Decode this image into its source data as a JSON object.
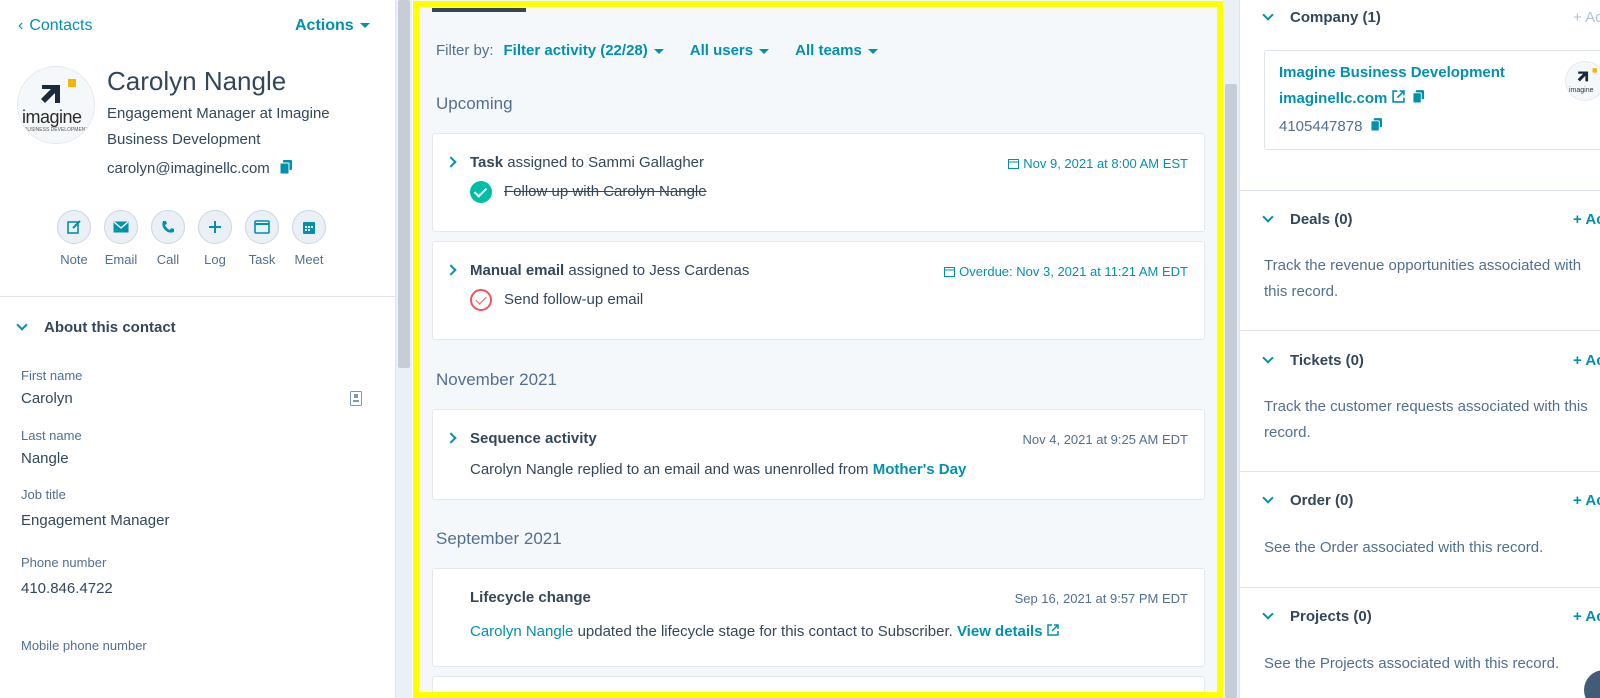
{
  "left": {
    "back_label": "Contacts",
    "actions_label": "Actions",
    "logo_word": "imagine",
    "logo_sub": "BUSINESS DEVELOPMENT",
    "name": "Carolyn Nangle",
    "title": "Engagement Manager at Imagine Business Development",
    "email": "carolyn@imaginellc.com",
    "quick_actions": [
      {
        "label": "Note",
        "icon": "edit-icon"
      },
      {
        "label": "Email",
        "icon": "envelope-icon"
      },
      {
        "label": "Call",
        "icon": "phone-icon"
      },
      {
        "label": "Log",
        "icon": "plus-icon"
      },
      {
        "label": "Task",
        "icon": "task-icon"
      },
      {
        "label": "Meet",
        "icon": "calendar-icon"
      }
    ],
    "about_label": "About this contact",
    "properties": [
      {
        "label": "First name",
        "value": "Carolyn"
      },
      {
        "label": "Last name",
        "value": "Nangle"
      },
      {
        "label": "Job title",
        "value": "Engagement Manager"
      },
      {
        "label": "Phone number",
        "value": "410.846.4722"
      },
      {
        "label": "Mobile phone number",
        "value": ""
      }
    ]
  },
  "center": {
    "filter_by_label": "Filter by:",
    "filter_activity": "Filter activity (22/28)",
    "filter_users": "All users",
    "filter_teams": "All teams",
    "sections": {
      "upcoming": "Upcoming",
      "nov": "November 2021",
      "sep": "September 2021"
    },
    "cards": {
      "task": {
        "type": "Task",
        "assigned_text": "assigned to Sammi Gallagher",
        "date": "Nov 9, 2021 at 8:00 AM EST",
        "body": "Follow up with Carolyn Nangle"
      },
      "email": {
        "type": "Manual email",
        "assigned_text": "assigned to Jess Cardenas",
        "date": "Overdue: Nov 3, 2021 at 11:21 AM EDT",
        "body": "Send follow-up email"
      },
      "sequence": {
        "type": "Sequence activity",
        "date": "Nov 4, 2021 at 9:25 AM EDT",
        "body_prefix": "Carolyn Nangle replied to an email and was unenrolled from",
        "body_link": "Mother's Day"
      },
      "lifecycle": {
        "type": "Lifecycle change",
        "date": "Sep 16, 2021 at 9:57 PM EDT",
        "body_link": "Carolyn Nangle",
        "body_text": "updated the lifecycle stage for this contact to Subscriber.",
        "details_link": "View details"
      }
    }
  },
  "right": {
    "company": {
      "header": "Company (1)",
      "add": "+ Ac",
      "name": "Imagine Business Development",
      "domain": "imaginellc.com",
      "phone": "4105447878",
      "logo_word": "imagine"
    },
    "deals": {
      "header": "Deals (0)",
      "add": "+ Ac",
      "desc": "Track the revenue opportunities associated with this record."
    },
    "tickets": {
      "header": "Tickets (0)",
      "add": "+ Ac",
      "desc": "Track the customer requests associated with this record."
    },
    "order": {
      "header": "Order (0)",
      "add": "+ Ac",
      "desc": "See the Order associated with this record."
    },
    "projects": {
      "header": "Projects (0)",
      "add": "+ Ac",
      "desc": "See the Projects associated with this record."
    }
  }
}
